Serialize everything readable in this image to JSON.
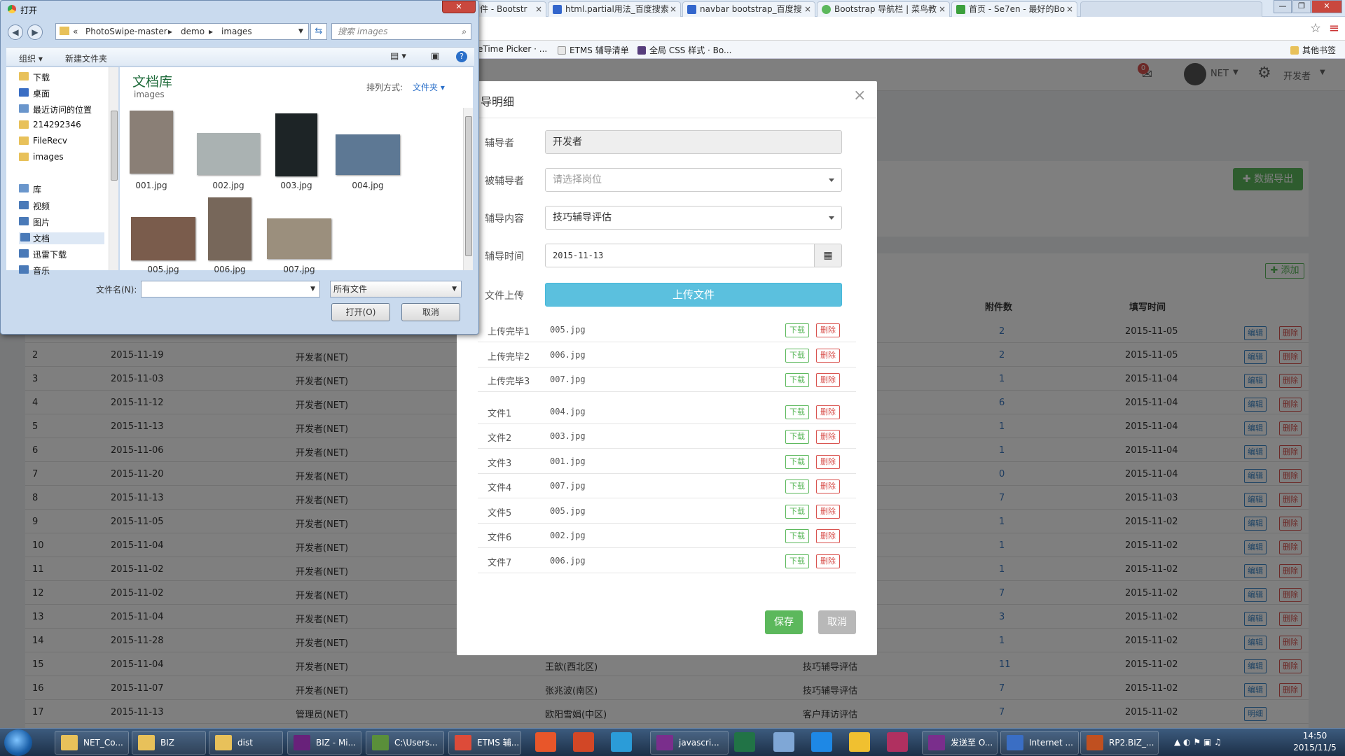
{
  "browser": {
    "tabs": [
      {
        "label": "件 - Bootstr",
        "favicon_color": "#f2f2f2"
      },
      {
        "label": "html.partial用法_百度搜索",
        "favicon_color": "#3366cc"
      },
      {
        "label": "navbar bootstrap_百度搜",
        "favicon_color": "#3366cc"
      },
      {
        "label": "Bootstrap 导航栏 | 菜鸟教",
        "favicon_color": "#5cb85c"
      },
      {
        "label": "首页 - Se7en - 最好的Bo",
        "favicon_color": "#3ca03c"
      }
    ],
    "tab_close": "×",
    "bookmarks": [
      {
        "label": "eTime Picker · ...",
        "color": "#e8e8e8"
      },
      {
        "label": "ETMS 辅导清单",
        "color": "#e8e8e8"
      },
      {
        "label": "全局 CSS 样式 · Bo...",
        "color": "#563d7c"
      }
    ],
    "other_bookmarks": "其他书签"
  },
  "app": {
    "user": "NET",
    "role": "开发者",
    "notification_count": "0",
    "export_button": "数据导出",
    "add_button": "添加",
    "table": {
      "headers": {
        "attachments": "附件数",
        "filled_time": "填写时间"
      },
      "rows": [
        {
          "no": "",
          "date": "",
          "author": "",
          "mentee": "",
          "content": "",
          "attachments": "2",
          "filled": "2015-11-05",
          "actions": [
            "编辑",
            "删除"
          ]
        },
        {
          "no": "2",
          "date": "2015-11-19",
          "author": "开发者(NET)",
          "mentee": "",
          "content": "",
          "attachments": "2",
          "filled": "2015-11-05",
          "actions": [
            "编辑",
            "删除"
          ]
        },
        {
          "no": "3",
          "date": "2015-11-03",
          "author": "开发者(NET)",
          "mentee": "",
          "content": "",
          "attachments": "1",
          "filled": "2015-11-04",
          "actions": [
            "编辑",
            "删除"
          ]
        },
        {
          "no": "4",
          "date": "2015-11-12",
          "author": "开发者(NET)",
          "mentee": "",
          "content": "",
          "attachments": "6",
          "filled": "2015-11-04",
          "actions": [
            "编辑",
            "删除"
          ]
        },
        {
          "no": "5",
          "date": "2015-11-13",
          "author": "开发者(NET)",
          "mentee": "",
          "content": "",
          "attachments": "1",
          "filled": "2015-11-04",
          "actions": [
            "编辑",
            "删除"
          ]
        },
        {
          "no": "6",
          "date": "2015-11-06",
          "author": "开发者(NET)",
          "mentee": "",
          "content": "",
          "attachments": "1",
          "filled": "2015-11-04",
          "actions": [
            "编辑",
            "删除"
          ]
        },
        {
          "no": "7",
          "date": "2015-11-20",
          "author": "开发者(NET)",
          "mentee": "",
          "content": "",
          "attachments": "0",
          "filled": "2015-11-04",
          "actions": [
            "编辑",
            "删除"
          ]
        },
        {
          "no": "8",
          "date": "2015-11-13",
          "author": "开发者(NET)",
          "mentee": "",
          "content": "",
          "attachments": "7",
          "filled": "2015-11-03",
          "actions": [
            "编辑",
            "删除"
          ]
        },
        {
          "no": "9",
          "date": "2015-11-05",
          "author": "开发者(NET)",
          "mentee": "",
          "content": "",
          "attachments": "1",
          "filled": "2015-11-02",
          "actions": [
            "编辑",
            "删除"
          ]
        },
        {
          "no": "10",
          "date": "2015-11-04",
          "author": "开发者(NET)",
          "mentee": "",
          "content": "",
          "attachments": "1",
          "filled": "2015-11-02",
          "actions": [
            "编辑",
            "删除"
          ]
        },
        {
          "no": "11",
          "date": "2015-11-02",
          "author": "开发者(NET)",
          "mentee": "",
          "content": "",
          "attachments": "1",
          "filled": "2015-11-02",
          "actions": [
            "编辑",
            "删除"
          ]
        },
        {
          "no": "12",
          "date": "2015-11-02",
          "author": "开发者(NET)",
          "mentee": "",
          "content": "",
          "attachments": "7",
          "filled": "2015-11-02",
          "actions": [
            "编辑",
            "删除"
          ]
        },
        {
          "no": "13",
          "date": "2015-11-04",
          "author": "开发者(NET)",
          "mentee": "",
          "content": "",
          "attachments": "3",
          "filled": "2015-11-02",
          "actions": [
            "编辑",
            "删除"
          ]
        },
        {
          "no": "14",
          "date": "2015-11-28",
          "author": "开发者(NET)",
          "mentee": "",
          "content": "",
          "attachments": "1",
          "filled": "2015-11-02",
          "actions": [
            "编辑",
            "删除"
          ]
        },
        {
          "no": "15",
          "date": "2015-11-04",
          "author": "开发者(NET)",
          "mentee": "王歆(西北区)",
          "content": "技巧辅导评估",
          "attachments": "11",
          "filled": "2015-11-02",
          "actions": [
            "编辑",
            "删除"
          ]
        },
        {
          "no": "16",
          "date": "2015-11-07",
          "author": "开发者(NET)",
          "mentee": "张兆波(南区)",
          "content": "技巧辅导评估",
          "attachments": "7",
          "filled": "2015-11-02",
          "actions": [
            "编辑",
            "删除"
          ]
        },
        {
          "no": "17",
          "date": "2015-11-13",
          "author": "管理员(NET)",
          "mentee": "欧阳雪娟(中区)",
          "content": "客户拜访评估",
          "attachments": "7",
          "filled": "2015-11-02",
          "actions": [
            "明细"
          ]
        }
      ]
    }
  },
  "modal": {
    "title": "导明细",
    "close": "×",
    "fields": {
      "mentor_label": "辅导者",
      "mentor_value": "开发者",
      "mentee_label": "被辅导者",
      "mentee_placeholder": "请选择岗位",
      "content_label": "辅导内容",
      "content_value": "技巧辅导评估",
      "time_label": "辅导时间",
      "time_value": "2015-11-13",
      "upload_label": "文件上传",
      "upload_button": "上传文件"
    },
    "files": [
      {
        "label": "上传完毕1",
        "name": "005.jpg"
      },
      {
        "label": "上传完毕2",
        "name": "006.jpg"
      },
      {
        "label": "上传完毕3",
        "name": "007.jpg"
      },
      {
        "label": "文件1",
        "name": "004.jpg"
      },
      {
        "label": "文件2",
        "name": "003.jpg"
      },
      {
        "label": "文件3",
        "name": "001.jpg"
      },
      {
        "label": "文件4",
        "name": "007.jpg"
      },
      {
        "label": "文件5",
        "name": "005.jpg"
      },
      {
        "label": "文件6",
        "name": "002.jpg"
      },
      {
        "label": "文件7",
        "name": "006.jpg"
      }
    ],
    "download": "下载",
    "delete": "删除",
    "save": "保存",
    "cancel": "取消"
  },
  "dialog": {
    "title": "打开",
    "breadcrumb": [
      "«",
      "PhotoSwipe-master",
      "demo",
      "images"
    ],
    "search_placeholder": "搜索 images",
    "organize": "组织 ▾",
    "new_folder": "新建文件夹",
    "tree": {
      "favorites": [
        "下载",
        "桌面",
        "最近访问的位置",
        "214292346",
        "FileRecv",
        "images"
      ],
      "library": "库",
      "library_items": [
        "视频",
        "图片",
        "文档",
        "迅雷下载",
        "音乐"
      ]
    },
    "library_title": "文档库",
    "library_subtitle": "images",
    "sort_label": "排列方式:",
    "sort_value": "文件夹 ▾",
    "files": [
      {
        "name": "001.jpg",
        "color": "#8a7f76"
      },
      {
        "name": "002.jpg",
        "color": "#aab2b2"
      },
      {
        "name": "003.jpg",
        "color": "#1d2426"
      },
      {
        "name": "004.jpg",
        "color": "#5d7894"
      },
      {
        "name": "005.jpg",
        "color": "#7a5c4c"
      },
      {
        "name": "006.jpg",
        "color": "#77675a"
      },
      {
        "name": "007.jpg",
        "color": "#9b8f7d"
      }
    ],
    "filename_label": "文件名(N):",
    "filename_value": "",
    "filter_value": "所有文件",
    "open_button": "打开(O)",
    "cancel_button": "取消"
  },
  "taskbar": {
    "items": [
      {
        "label": "NET_Co...",
        "color": "#e8c15a"
      },
      {
        "label": "BIZ",
        "color": "#e8c15a"
      },
      {
        "label": "dist",
        "color": "#e8c15a"
      },
      {
        "label": "BIZ - Mi...",
        "color": "#68217a"
      },
      {
        "label": "C:\\Users...",
        "color": "#5a8f3a"
      },
      {
        "label": "ETMS 辅...",
        "color": "#dd4b39"
      },
      {
        "label": "javascri...",
        "color": "#7a2e8c"
      },
      {
        "label": "发送至 O...",
        "color": "#7a2e8c"
      },
      {
        "label": "Internet ...",
        "color": "#3a6ec4"
      },
      {
        "label": "RP2.BIZ_...",
        "color": "#c05020"
      }
    ],
    "time": "14:50",
    "date": "2015/11/5"
  }
}
